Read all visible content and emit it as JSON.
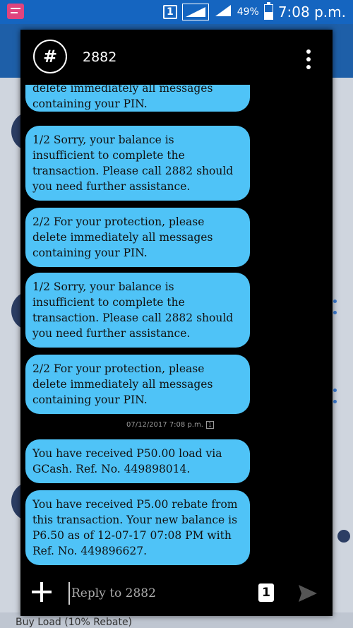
{
  "status_bar": {
    "sim_slot": "1",
    "battery_percent": "49%",
    "time": "7:08 p.m."
  },
  "background": {
    "bottom_label": "Buy Load (10% Rebate)"
  },
  "conversation": {
    "title": "2882",
    "avatar_symbol": "#",
    "messages": [
      {
        "lines": [
          "delete immediately all messages",
          "containing your PIN."
        ]
      },
      {
        "lines": [
          "1/2 Sorry, your balance is",
          "insufficient to complete the",
          "transaction. Please call 2882 should",
          "you need further assistance."
        ]
      },
      {
        "lines": [
          "2/2 For your protection, please",
          "delete immediately all messages",
          "containing your PIN."
        ]
      },
      {
        "lines": [
          "1/2 Sorry, your balance is",
          "insufficient to complete the",
          "transaction. Please call 2882 should",
          "you need further assistance."
        ]
      },
      {
        "lines": [
          "2/2 For your protection, please",
          "delete immediately all messages",
          "containing your PIN."
        ]
      },
      {
        "lines": [
          "You have received P50.00 load via",
          "GCash. Ref. No. 449898014."
        ]
      },
      {
        "lines": [
          "You have received P5.00 rebate from",
          "this transaction. Your new balance is",
          "P6.50 as of 12-07-17 07:08 PM with",
          "Ref. No. 449896627."
        ]
      }
    ],
    "timestamp": "07/12/2017 7:08 p.m.",
    "timestamp_sim": "1"
  },
  "composer": {
    "placeholder": "Reply to 2882",
    "sim_button": "1"
  }
}
